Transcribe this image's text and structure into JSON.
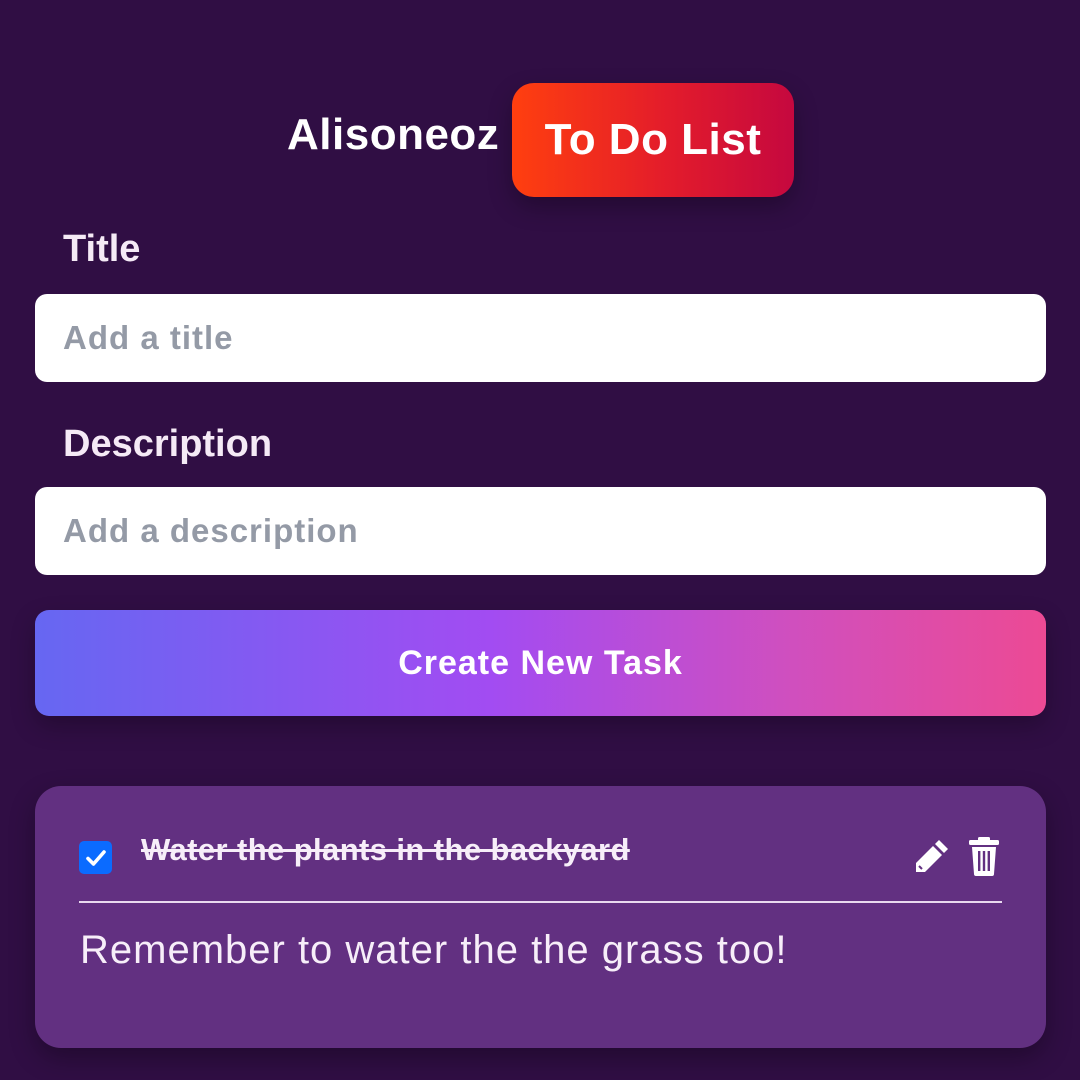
{
  "header": {
    "brand": "Alisoneoz",
    "badge": "To Do List"
  },
  "form": {
    "title_label": "Title",
    "title_placeholder": "Add a title",
    "title_value": "",
    "description_label": "Description",
    "description_placeholder": "Add a description",
    "description_value": "",
    "create_button": "Create New Task"
  },
  "tasks": [
    {
      "title": "Water the plants in the backyard",
      "description": "Remember to water the the grass too!",
      "completed": true,
      "checkbox_icon": "check-icon",
      "edit_icon": "pencil-icon",
      "delete_icon": "trash-icon"
    }
  ],
  "colors": {
    "background": "#300e44",
    "badge_gradient_start": "#ff3f0f",
    "badge_gradient_end": "#c5083f",
    "button_gradient_start": "#6667f2",
    "button_gradient_end": "#ec4a94",
    "card_background": "#623081",
    "checkbox": "#0b6bff"
  }
}
